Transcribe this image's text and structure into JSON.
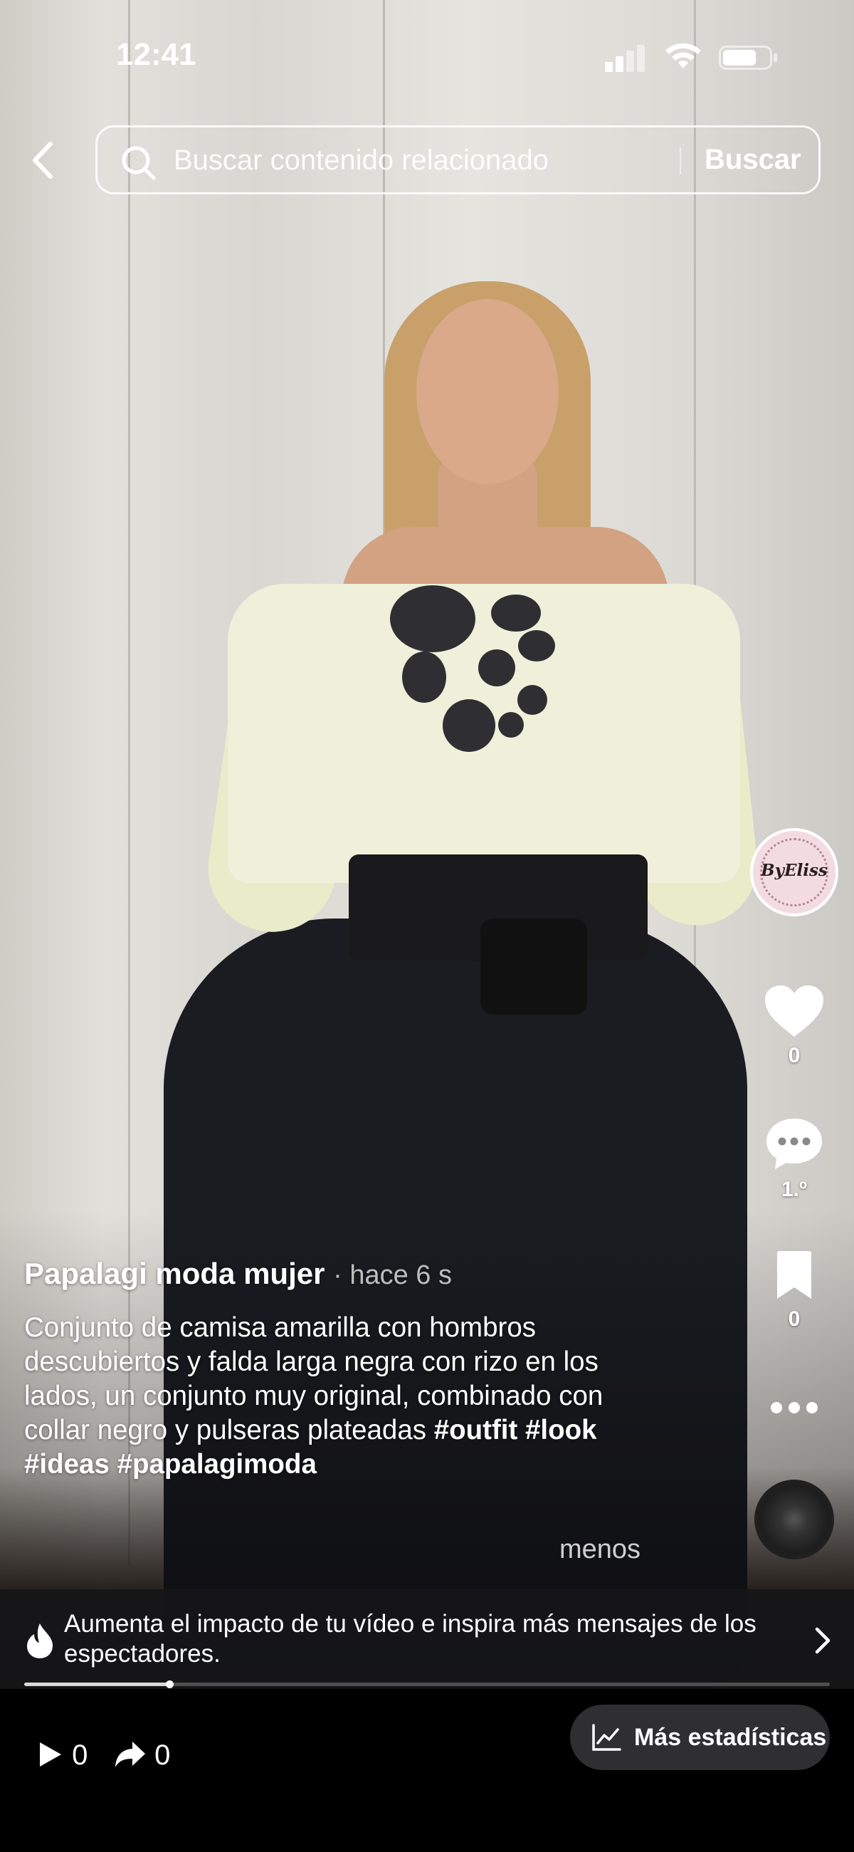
{
  "status_bar": {
    "time": "12:41"
  },
  "search": {
    "placeholder": "Buscar contenido relacionado",
    "submit_label": "Buscar"
  },
  "post": {
    "author": "Papalagi moda mujer",
    "time_ago": "· hace 6 s",
    "caption": "Conjunto de camisa amarilla con hombros descubiertos y falda larga negra con rizo en los lados, un conjunto muy original, combinado con collar negro y pulseras plateadas",
    "hashtags": [
      "#outfit",
      "#look",
      "#ideas",
      "#papalagimoda"
    ],
    "less_label": "menos"
  },
  "actions": {
    "avatar_text": "ByEliss",
    "likes": "0",
    "comments": "1.º",
    "saves": "0",
    "icons": [
      "heart-icon",
      "comment-icon",
      "bookmark-icon",
      "more-icon",
      "music-disc-icon"
    ]
  },
  "promo": {
    "text": "Aumenta el impacto de tu vídeo e inspira más mensajes de los espectadores."
  },
  "playback": {
    "progress": 0.18
  },
  "bottom_bar": {
    "plays": "0",
    "shares": "0",
    "stats_label": "Más estadísticas"
  },
  "colors": {
    "accent_background": "#2f2f31",
    "text": "#ffffff"
  }
}
